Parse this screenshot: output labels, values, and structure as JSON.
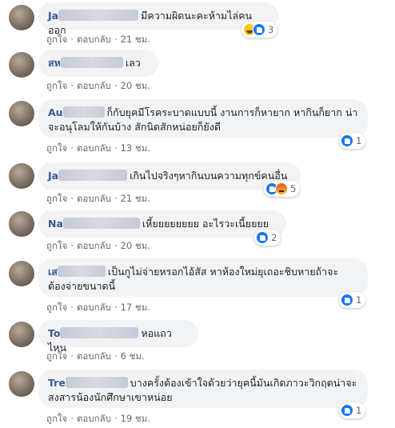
{
  "action_like": "ถูกใจ",
  "action_reply": "ตอบกลับ",
  "separator": "·",
  "comments": [
    {
      "author": "Ja",
      "text": "มีความผิดนะคะห้ามไล่คนออก",
      "time": "21 ชม.",
      "reactions": [
        "haha",
        "like"
      ],
      "count": "3"
    },
    {
      "author": "สห",
      "text": "เลว",
      "time": "20 ชม.",
      "reactions": [],
      "count": ""
    },
    {
      "author": "Au",
      "text_line1": "ก็กับยุคมีโรคระบาดแบบนี้ งานการก็หายาก หากินก็ยาก น่า",
      "text_line2": "จะอนุโลมให้กันบ้าง สักนิดสักหน่อยก็ยังดี",
      "time": "13 ชม.",
      "reactions": [
        "like"
      ],
      "count": "1"
    },
    {
      "author": "Ja",
      "text": "เกินไปจริงๆหากินบนความทุกข์คนอื่น",
      "time": "21 ชม.",
      "reactions": [
        "like",
        "angry"
      ],
      "count": "5"
    },
    {
      "author": "Na",
      "text": "เหี้ยยยยยยยย อะไรวะเนี้ยยยย",
      "time": "20 ชม.",
      "reactions": [
        "like"
      ],
      "count": "2"
    },
    {
      "author": "เส",
      "text_line1": "เป็นกูไม่จ่ายหรอกไอ้สัส หาห้องใหม่ยุเถอะชิบหายถ้าจะ",
      "text_line2": "ต้องจ่ายขนาดนี้",
      "time": "17 ชม.",
      "reactions": [
        "like"
      ],
      "count": "1"
    },
    {
      "author": "To",
      "text": "หอแถวไหน",
      "time": "6 ชม.",
      "reactions": [],
      "count": ""
    },
    {
      "author": "Tre",
      "text_line1": "บางครั้งต้องเข้าใจด้วยว่ายุคนี้มันเกิดภาวะวิกฤตน่าจะ",
      "text_line2": "สงสารน้องนักศึกษาเขาหน่อย",
      "time": "19 ชม.",
      "reactions": [
        "like"
      ],
      "count": "1"
    }
  ]
}
